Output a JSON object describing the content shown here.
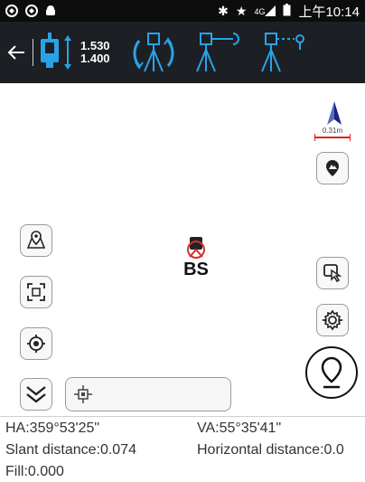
{
  "status_bar": {
    "left_icons": [
      "app-icon-1",
      "app-icon-2",
      "android-icon"
    ],
    "right_icons": [
      "bluetooth-icon",
      "star-icon",
      "signal-4g-icon",
      "battery-icon"
    ],
    "network": "4G",
    "time": "上午10:14"
  },
  "toolbar": {
    "height_top": "1.530",
    "height_bottom": "1.400",
    "accent_color": "#29a3e8",
    "tools": [
      {
        "name": "rotate-instrument-icon"
      },
      {
        "name": "backsight-orient-icon"
      },
      {
        "name": "point-orient-icon"
      }
    ]
  },
  "map": {
    "scale_label": "0.31m",
    "marker_label": "BS",
    "left_controls": [
      "map-layer-icon",
      "fit-extent-icon",
      "locate-icon",
      "collapse-icon"
    ],
    "right_controls": [
      "map-mode-icon",
      "touch-select-icon",
      "settings-icon",
      "stakeout-pin-icon"
    ]
  },
  "info": {
    "ha": "HA:359°53'25\"",
    "va": "VA:55°35'41\"",
    "slant": "Slant distance:0.074",
    "horizontal": "Horizontal distance:0.0",
    "fill": "Fill:0.000"
  }
}
